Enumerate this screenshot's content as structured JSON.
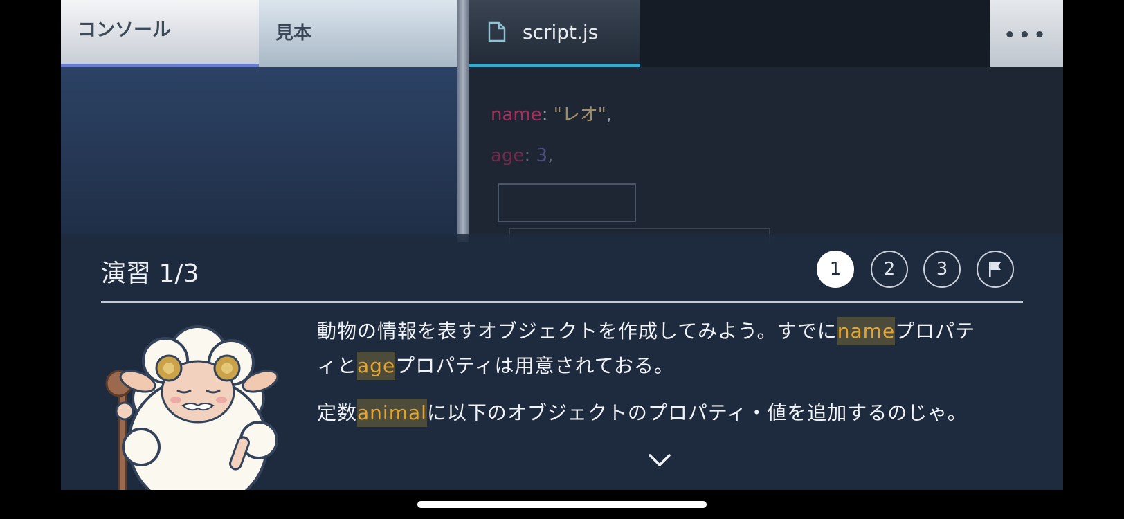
{
  "tabs": {
    "console": "コンソール",
    "sample": "見本",
    "file": "script.js",
    "more": "•••"
  },
  "code": {
    "line1_key": "name",
    "line1_value": "\"レオ\"",
    "line2_key": "age",
    "line2_value": "3"
  },
  "exercise": {
    "title": "演習 1/3",
    "steps": [
      "1",
      "2",
      "3"
    ],
    "paragraph1": {
      "part1": "動物の情報を表すオブジェクトを作成してみよう。すでに",
      "hl1": "name",
      "part2": "プロパティと",
      "hl2": "age",
      "part3": "プロパティは用意されておる。"
    },
    "paragraph2": {
      "part1": "定数",
      "hl1": "animal",
      "part2": "に以下のオブジェクトのプロパティ・値を追加するのじゃ。"
    }
  },
  "colors": {
    "accent_console": "#6a7dcb",
    "accent_file": "#3ba8c7",
    "highlight_text": "#e3a634",
    "sheet_bg": "#1e2b3e"
  }
}
